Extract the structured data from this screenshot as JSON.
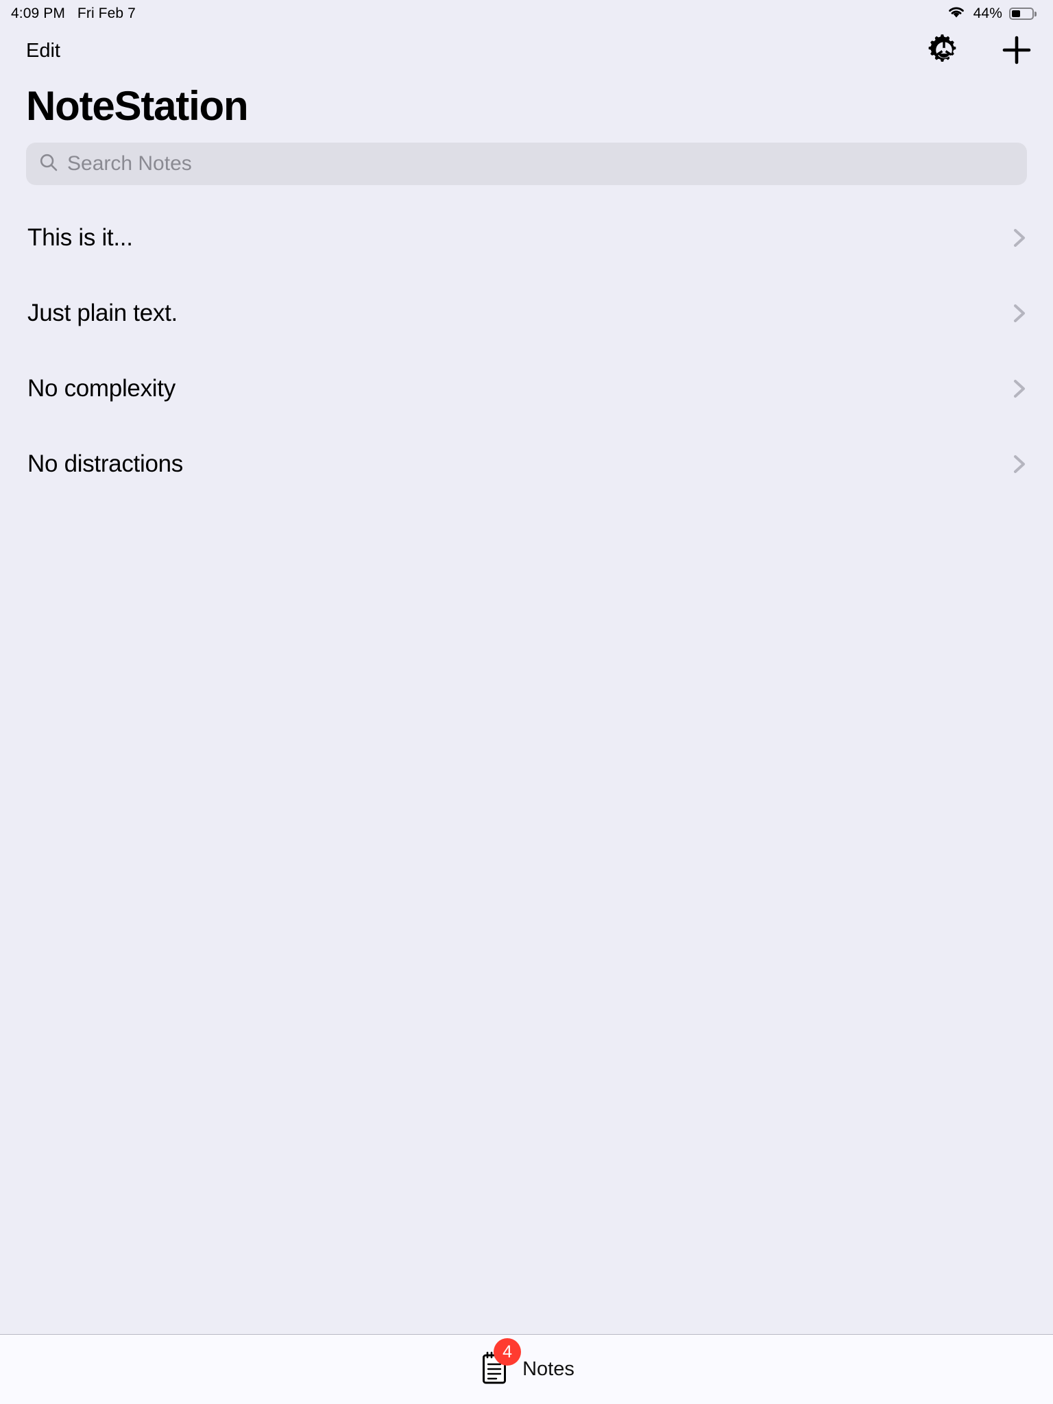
{
  "status_bar": {
    "time": "4:09 PM",
    "date": "Fri Feb 7",
    "wifi_icon": "wifi-icon",
    "battery_percent": "44%",
    "battery_level": 44,
    "battery_icon": "battery-icon"
  },
  "nav": {
    "edit_label": "Edit",
    "settings_icon": "gear-icon",
    "add_icon": "plus-icon"
  },
  "header": {
    "title": "NoteStation"
  },
  "search": {
    "placeholder": "Search Notes",
    "value": "",
    "icon": "search-icon"
  },
  "notes": [
    {
      "title": "This is it...",
      "chevron": "chevron-right-icon"
    },
    {
      "title": "Just plain text.",
      "chevron": "chevron-right-icon"
    },
    {
      "title": "No complexity",
      "chevron": "chevron-right-icon"
    },
    {
      "title": "No distractions",
      "chevron": "chevron-right-icon"
    }
  ],
  "tabbar": {
    "items": [
      {
        "label": "Notes",
        "icon": "notepad-icon",
        "badge": "4",
        "selected": true
      }
    ]
  },
  "colors": {
    "background": "#ededf6",
    "search_fill": "#dedee6",
    "tabbar_background": "#fafaff",
    "badge_red": "#ff3b30",
    "chevron_gray": "#b5b5bf",
    "placeholder_gray": "#8a8a92"
  }
}
